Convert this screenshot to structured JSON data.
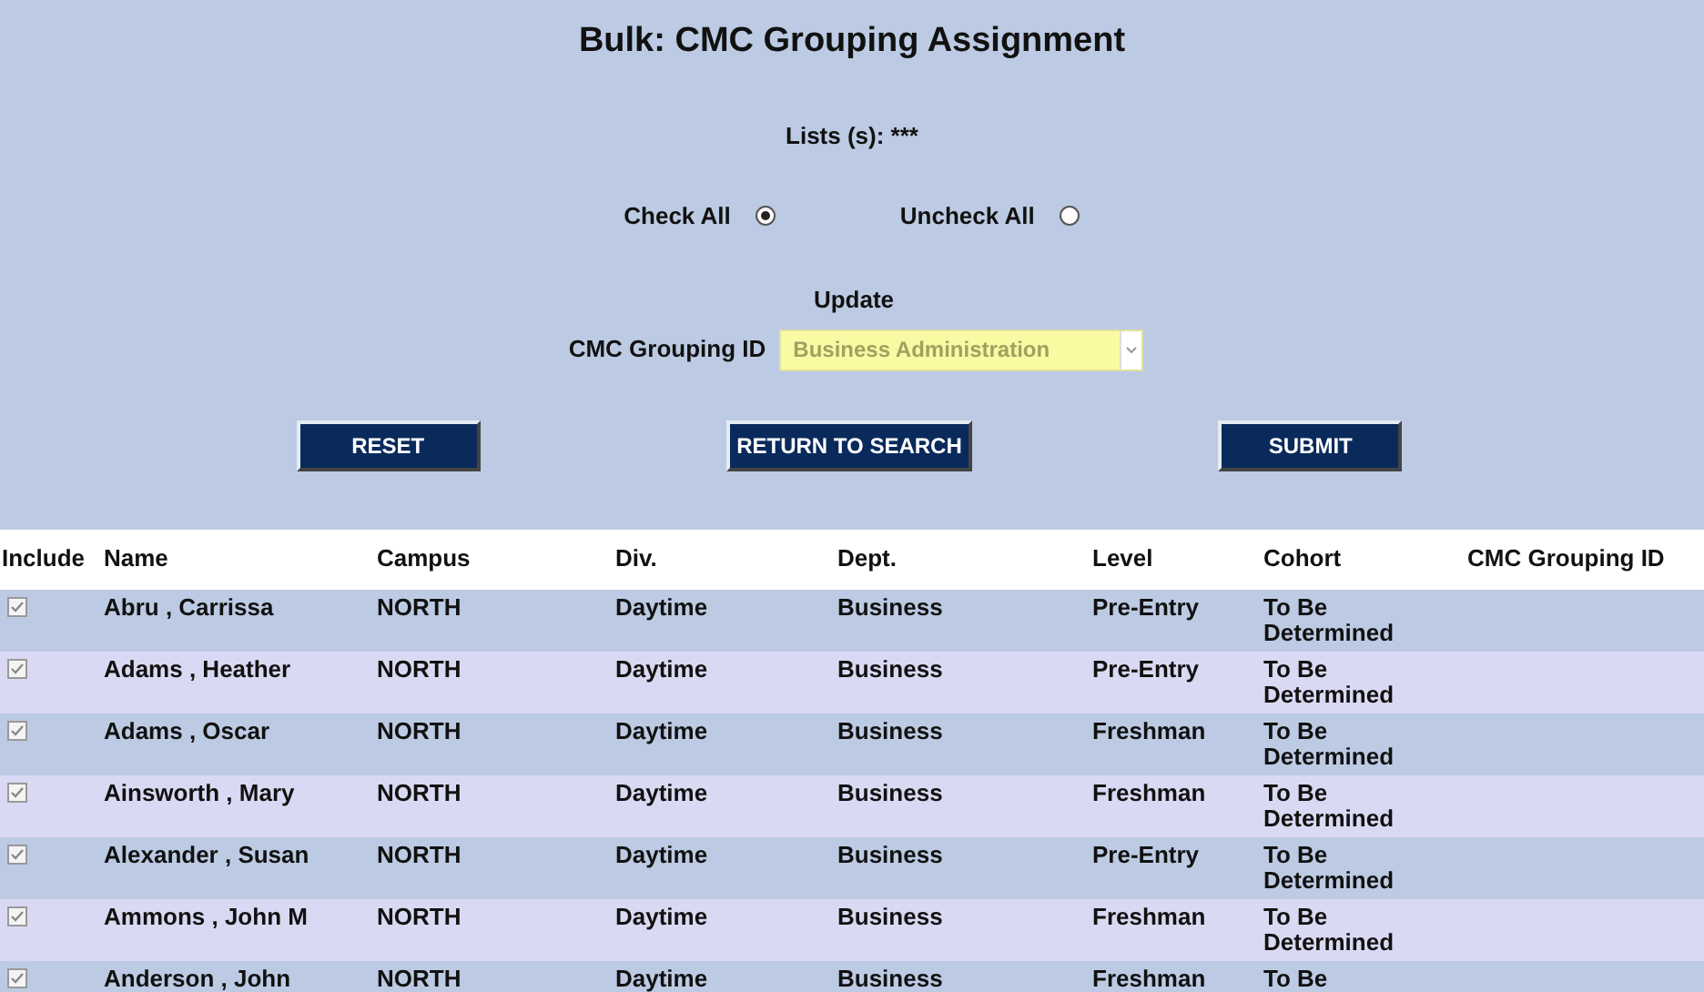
{
  "title": "Bulk: CMC Grouping Assignment",
  "lists_label": "Lists (s): ***",
  "check_options": [
    {
      "label": "Check All",
      "selected": true
    },
    {
      "label": "Uncheck All",
      "selected": false
    }
  ],
  "update_heading": "Update",
  "grouping_field": {
    "label": "CMC Grouping ID",
    "value": "Business Administration"
  },
  "buttons": [
    "RESET",
    "RETURN TO SEARCH",
    "SUBMIT"
  ],
  "table": {
    "columns": [
      "Include",
      "Name",
      "Campus",
      "Div.",
      "Dept.",
      "Level",
      "Cohort",
      "CMC Grouping ID"
    ],
    "rows": [
      {
        "checked": true,
        "name": "Abru , Carrissa",
        "campus": "NORTH",
        "div": "Daytime",
        "dept": "Business",
        "level": "Pre-Entry",
        "cohort": "To Be Determined"
      },
      {
        "checked": true,
        "name": "Adams , Heather",
        "campus": "NORTH",
        "div": "Daytime",
        "dept": "Business",
        "level": "Pre-Entry",
        "cohort": "To Be Determined"
      },
      {
        "checked": true,
        "name": "Adams , Oscar",
        "campus": "NORTH",
        "div": "Daytime",
        "dept": "Business",
        "level": "Freshman",
        "cohort": "To Be Determined"
      },
      {
        "checked": true,
        "name": "Ainsworth , Mary",
        "campus": "NORTH",
        "div": "Daytime",
        "dept": "Business",
        "level": "Freshman",
        "cohort": "To Be Determined"
      },
      {
        "checked": true,
        "name": "Alexander , Susan",
        "campus": "NORTH",
        "div": "Daytime",
        "dept": "Business",
        "level": "Pre-Entry",
        "cohort": "To Be Determined"
      },
      {
        "checked": true,
        "name": "Ammons , John M",
        "campus": "NORTH",
        "div": "Daytime",
        "dept": "Business",
        "level": "Freshman",
        "cohort": "To Be Determined"
      },
      {
        "checked": true,
        "name": "Anderson , John",
        "campus": "NORTH",
        "div": "Daytime",
        "dept": "Business",
        "level": "Freshman",
        "cohort": "To Be"
      }
    ]
  }
}
